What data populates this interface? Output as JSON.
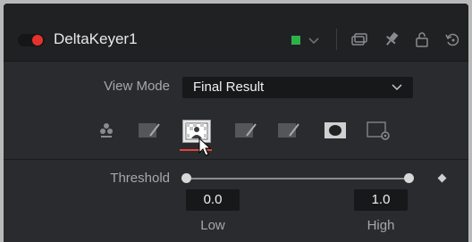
{
  "header": {
    "node_name": "DeltaKeyer1",
    "node_color": "#2db24a"
  },
  "view_mode": {
    "label": "View Mode",
    "selected": "Final Result"
  },
  "mode_icons": [
    "color-sample-icon",
    "pre-matte-icon",
    "matte-icon",
    "fine-matte-icon",
    "post-matte-icon",
    "garbage-matte-icon",
    "settings-icon"
  ],
  "threshold": {
    "label": "Threshold",
    "low": {
      "label": "Low",
      "value": "0.0"
    },
    "high": {
      "label": "High",
      "value": "1.0"
    }
  },
  "colors": {
    "accent_red": "#e5322c",
    "panel": "#2a2b2e",
    "header": "#202123"
  }
}
